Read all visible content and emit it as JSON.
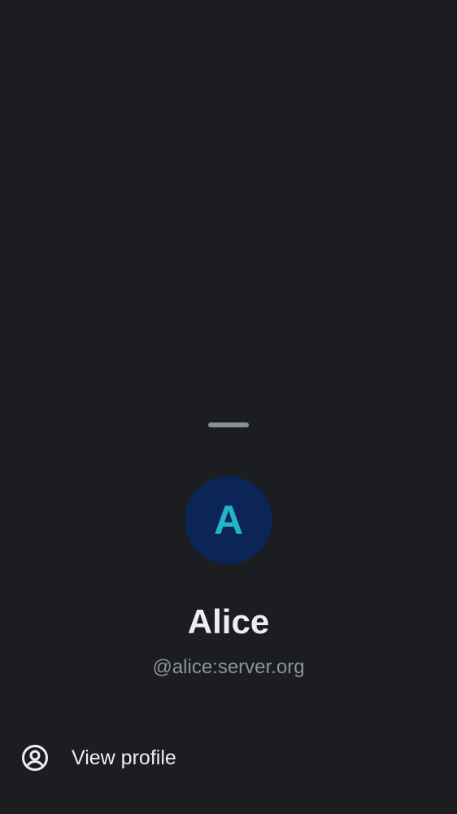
{
  "profile": {
    "avatar_initial": "A",
    "display_name": "Alice",
    "user_id": "@alice:server.org"
  },
  "menu": {
    "items": [
      {
        "label": "View profile",
        "icon": "user-circle-icon"
      }
    ]
  },
  "colors": {
    "background": "#1a1c20",
    "sheet": "#1b1d21",
    "avatar_bg": "#0b2556",
    "avatar_letter": "#22b5c9",
    "primary_text": "#eceef1",
    "secondary_text": "#8e939b"
  }
}
